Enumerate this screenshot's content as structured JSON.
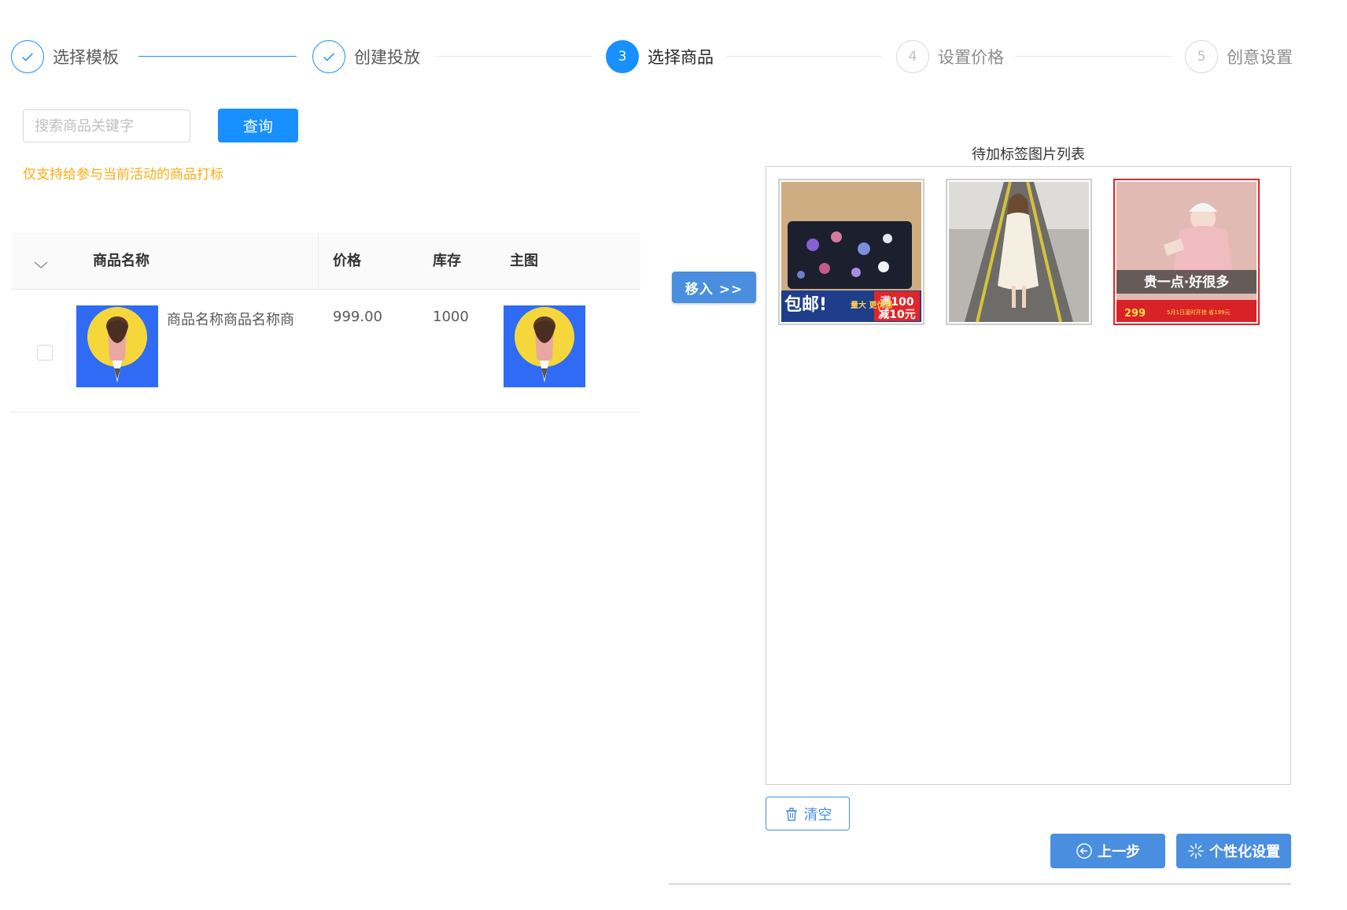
{
  "steps": [
    {
      "index": "1",
      "title": "选择模板",
      "status": "done"
    },
    {
      "index": "2",
      "title": "创建投放",
      "status": "done"
    },
    {
      "index": "3",
      "title": "选择商品",
      "status": "current"
    },
    {
      "index": "4",
      "title": "设置价格",
      "status": "wait"
    },
    {
      "index": "5",
      "title": "创意设置",
      "status": "wait"
    }
  ],
  "search": {
    "placeholder": "搜索商品关键字",
    "value": "",
    "button_label": "查询"
  },
  "tip": "仅支持给参与当前活动的商品打标",
  "table": {
    "headers": {
      "name": "商品名称",
      "price": "价格",
      "stock": "库存",
      "image": "主图"
    },
    "rows": [
      {
        "checked": false,
        "name": "商品名称商品名称商",
        "price": "999.00",
        "stock": "1000"
      }
    ]
  },
  "move_button_label": "移入 >>",
  "pending": {
    "title": "待加标签图片列表",
    "images": [
      {
        "overlay_text": "包邮!",
        "badge_small": "量大\n更优惠",
        "badge_top": "满100",
        "badge_bottom": "减10元"
      },
      {
        "overlay_text": ""
      },
      {
        "overlay_text": "贵一点·好很多",
        "price": "299",
        "note": "5月1日凌时开抢 省199元"
      }
    ]
  },
  "buttons": {
    "clear": "清空",
    "prev": "上一步",
    "custom": "个性化设置"
  },
  "colors": {
    "primary": "#1890ff",
    "button_blue": "#4a8ee0",
    "warning": "#faad14",
    "thumb_bg": "#2f6bf5",
    "thumb_moon": "#f5d73c"
  },
  "icons": {
    "done_step": "check-icon",
    "sort": "chevron-down-icon",
    "clear": "trash-icon",
    "prev": "arrow-left-circle-icon",
    "custom": "sparkle-icon"
  }
}
